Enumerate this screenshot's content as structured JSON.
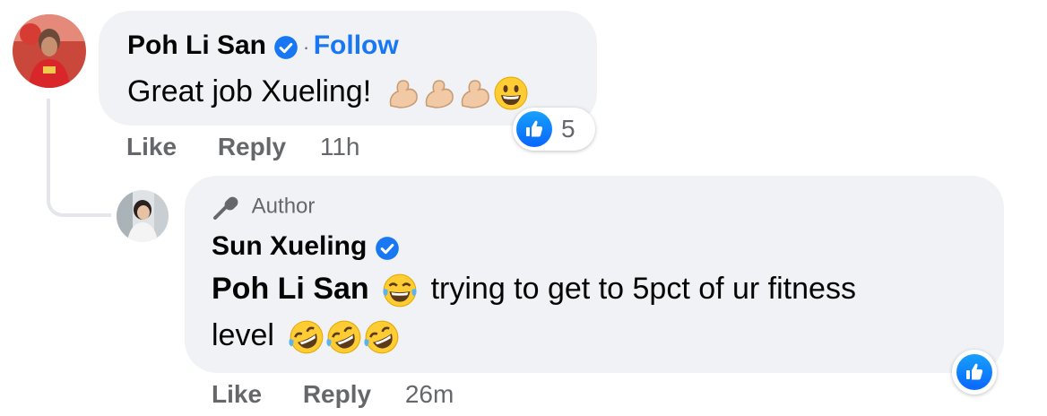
{
  "comment": {
    "author": "Poh Li San",
    "follow_separator": "·",
    "follow_label": "Follow",
    "text": "Great job Xueling!",
    "reaction_count": "5",
    "actions": {
      "like": "Like",
      "reply": "Reply",
      "time": "11h"
    },
    "emojis": [
      "flexed-biceps",
      "flexed-biceps",
      "flexed-biceps",
      "grinning-face"
    ]
  },
  "reply": {
    "badge": "Author",
    "author": "Sun Xueling",
    "mention": "Poh Li San",
    "text_part1": " trying to get to 5pct of ur fitness",
    "text_part2": "level",
    "actions": {
      "like": "Like",
      "reply": "Reply",
      "time": "26m"
    },
    "emojis": [
      "tears-of-joy",
      "rolling-laughing",
      "rolling-laughing",
      "rolling-laughing"
    ]
  },
  "colors": {
    "accent": "#1877f2",
    "bubble": "#f0f2f5",
    "muted": "#65676b"
  }
}
